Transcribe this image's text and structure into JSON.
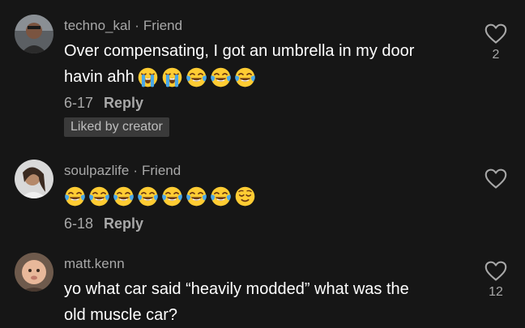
{
  "comments": [
    {
      "username": "techno_kal",
      "relation": "Friend",
      "text_line1": "Over compensating, I got an umbrella in my door",
      "text_line2": "havin ahh",
      "date": "6-17",
      "reply_label": "Reply",
      "badge": "Liked by creator",
      "like_count": "2",
      "emojis": [
        "loudly-crying-face",
        "loudly-crying-face",
        "face-with-tears-of-joy",
        "face-with-tears-of-joy",
        "face-with-tears-of-joy"
      ]
    },
    {
      "username": "soulpazlife",
      "relation": "Friend",
      "date": "6-18",
      "reply_label": "Reply",
      "like_count": "",
      "emojis": [
        "face-with-tears-of-joy",
        "face-with-tears-of-joy",
        "face-with-tears-of-joy",
        "face-with-tears-of-joy",
        "face-with-tears-of-joy",
        "face-with-tears-of-joy",
        "face-with-tears-of-joy",
        "relieved-face"
      ]
    },
    {
      "username": "matt.kenn",
      "text_line1": "yo what car said “heavily modded” what was the",
      "text_line2": "old muscle car?",
      "like_count": "12"
    }
  ],
  "colors": {
    "background": "#161616",
    "primary_text": "#ffffff",
    "secondary_text": "#a8a8a8",
    "badge_bg": "#3a3a3a",
    "emoji_yellow": "#ffcc33",
    "emoji_tear_blue": "#4aa8e8"
  },
  "icons": {
    "like": "heart-outline-icon"
  }
}
